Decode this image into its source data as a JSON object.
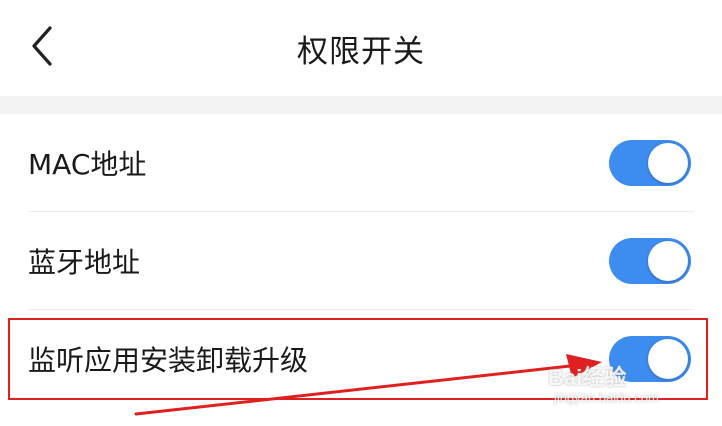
{
  "header": {
    "back_icon": "chevron-left-icon",
    "title": "权限开关"
  },
  "settings": [
    {
      "label": "MAC地址",
      "enabled": true
    },
    {
      "label": "蓝牙地址",
      "enabled": true
    },
    {
      "label": "监听应用安装卸载升级",
      "enabled": true
    }
  ],
  "colors": {
    "toggle_on": "#3d8cf0",
    "annotation": "#e02020",
    "gap_background": "#f3f3f3"
  },
  "watermark": {
    "brand": "Bai经验",
    "url": "jingyan.baidu.com"
  }
}
